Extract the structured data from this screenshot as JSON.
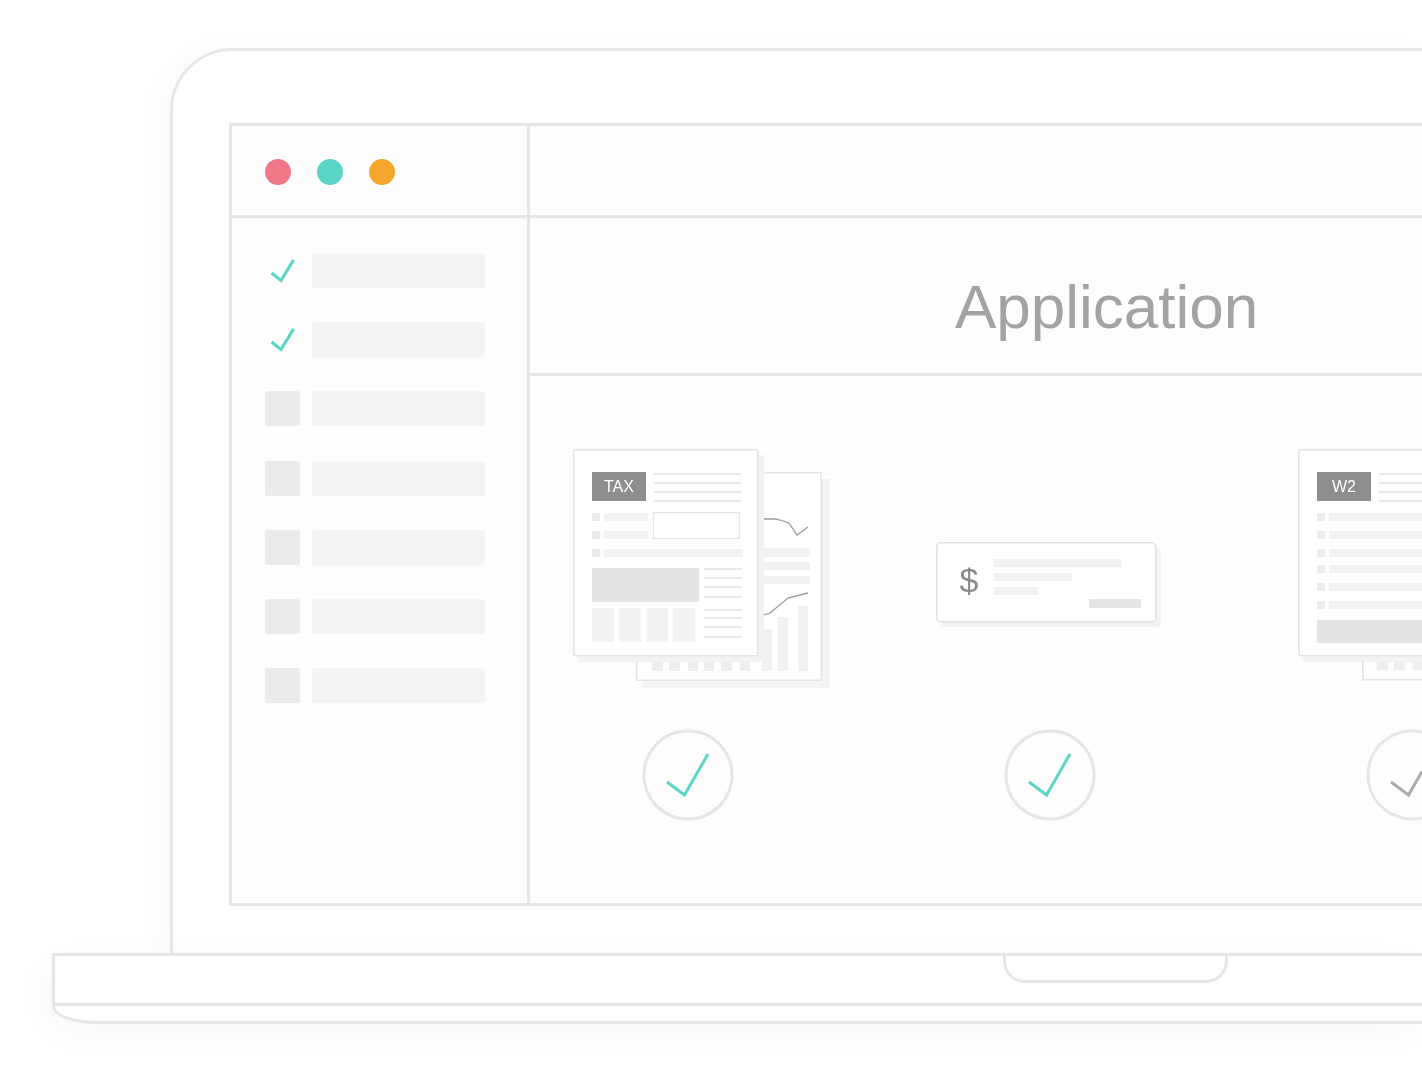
{
  "window": {
    "controls": [
      {
        "color": "#f07886"
      },
      {
        "color": "#5bd6c6"
      },
      {
        "color": "#f6a72b"
      }
    ],
    "title": "Application"
  },
  "sidebar": {
    "items": [
      {
        "checked": true
      },
      {
        "checked": true
      },
      {
        "checked": false
      },
      {
        "checked": false
      },
      {
        "checked": false
      },
      {
        "checked": false
      },
      {
        "checked": false
      }
    ]
  },
  "documents": [
    {
      "kind": "tax-form",
      "label": "TAX",
      "verified": true
    },
    {
      "kind": "check",
      "label": "$",
      "verified": true
    },
    {
      "kind": "w2-form",
      "label": "W2",
      "verified": false
    }
  ]
}
